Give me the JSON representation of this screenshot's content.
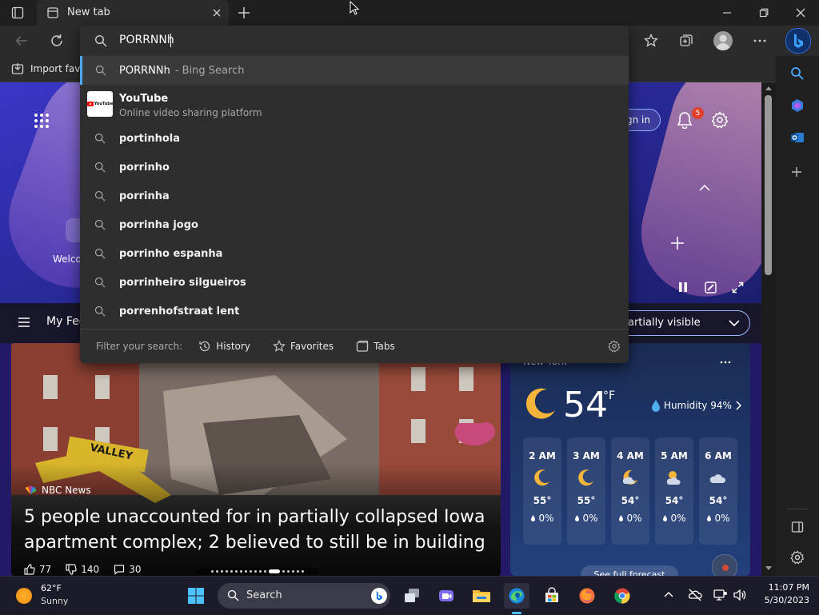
{
  "browser": {
    "tab_title": "New tab",
    "address_value": "PORRNNh",
    "favorites_bar": {
      "import_label": "Import favo"
    }
  },
  "dropdown": {
    "top_item": {
      "query": "PORRNNh",
      "suffix": "- Bing Search"
    },
    "youtube": {
      "title": "YouTube",
      "subtitle": "Online video sharing platform",
      "logo_text": "YouTube"
    },
    "suggestions": [
      "portinhola",
      "porrinho",
      "porrinha",
      "porrinha jogo",
      "porrinho espanha",
      "porrinheiro silgueiros",
      "porrenhofstraat lent"
    ],
    "filter_label": "Filter your search:",
    "filters": [
      "History",
      "Favorites",
      "Tabs"
    ]
  },
  "page": {
    "sign_in_label": "gn in",
    "notification_count": "5",
    "welcome_label": "Welco",
    "feed_tab_label": "My Fee",
    "partial_label": "artially visible",
    "news": {
      "source": "NBC News",
      "headline": "5 people unaccounted for in partially collapsed Iowa apartment complex; 2 believed to still be in building",
      "likes": "77",
      "dislikes": "140",
      "comments": "30",
      "sign_text": "VALLEY"
    },
    "weather": {
      "location": "New York",
      "temp": "54",
      "unit": "°F",
      "humidity": "Humidity 94%",
      "hours": [
        {
          "time": "2 AM",
          "temp": "55°",
          "precip": "0%",
          "icon": "moon-icon"
        },
        {
          "time": "3 AM",
          "temp": "55°",
          "precip": "0%",
          "icon": "moon-icon"
        },
        {
          "time": "4 AM",
          "temp": "54°",
          "precip": "0%",
          "icon": "moon-cloud-icon"
        },
        {
          "time": "5 AM",
          "temp": "54°",
          "precip": "0%",
          "icon": "sun-cloud-icon"
        },
        {
          "time": "6 AM",
          "temp": "54°",
          "precip": "0%",
          "icon": "cloud-icon"
        }
      ],
      "forecast_label": "See full forecast"
    }
  },
  "taskbar": {
    "weather_temp": "62°F",
    "weather_desc": "Sunny",
    "search_label": "Search",
    "time": "11:07 PM",
    "date": "5/30/2023"
  }
}
